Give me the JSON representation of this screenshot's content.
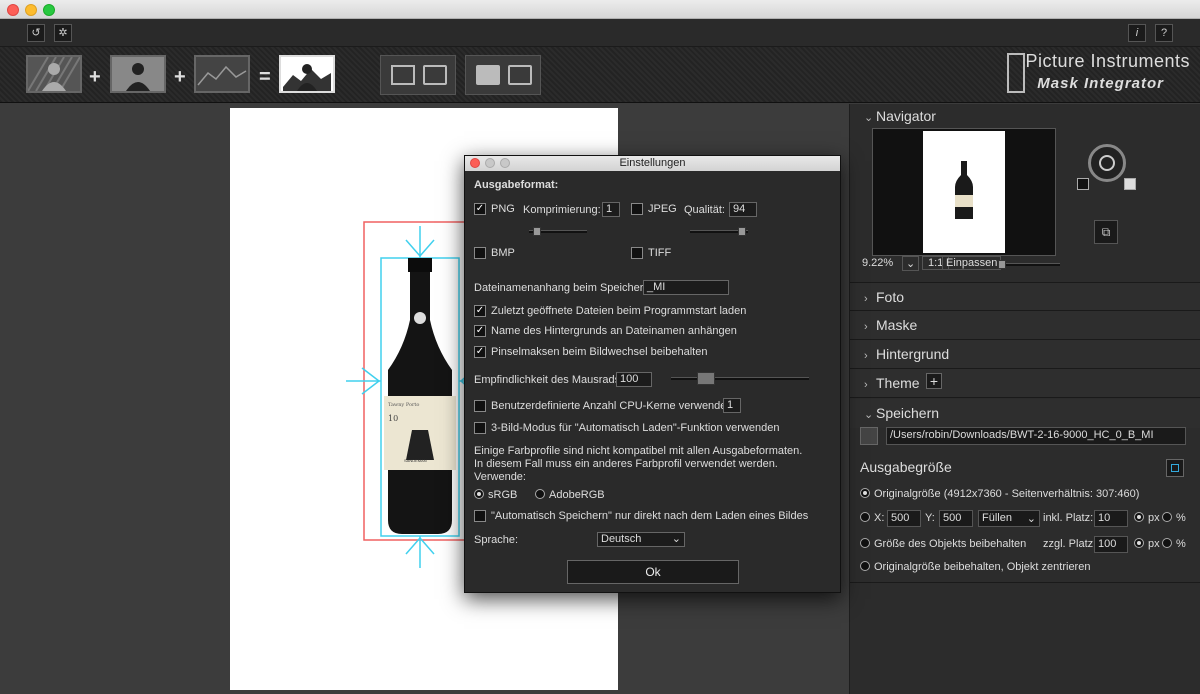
{
  "toolbar": {
    "plus1": "+",
    "plus2": "+",
    "equals": "=",
    "brand_line1": "Picture Instruments",
    "brand_line2": "Mask Integrator",
    "info_label": "i",
    "help_label": "?"
  },
  "navigator": {
    "title": "Navigator",
    "zoom": "9.22%",
    "ratio": "1:1",
    "fit_label": "Einpassen"
  },
  "sections": {
    "foto": "Foto",
    "maske": "Maske",
    "hintergrund": "Hintergrund",
    "theme": "Theme",
    "speichern": "Speichern"
  },
  "save": {
    "path": "/Users/robin/Downloads/BWT-2-16-9000_HC_0_B_MI",
    "output_size_title": "Ausgabegröße",
    "original_size": "Originalgröße (4912x7360 - Seitenverhältnis: 307:460)",
    "x_label": "X:",
    "x_value": "500",
    "y_label": "Y:",
    "y_value": "500",
    "fill_option": "Füllen",
    "inkl_label": "inkl. Platz:",
    "inkl_value": "10",
    "px_label": "px",
    "pct_label": "%",
    "keep_object_size": "Größe des Objekts beibehalten",
    "zzgl_label": "zzgl. Platz:",
    "zzgl_value": "100",
    "px_label2": "px",
    "pct_label2": "%",
    "keep_original_center": "Originalgröße beibehalten, Objekt zentrieren"
  },
  "dialog": {
    "title": "Einstellungen",
    "output_format": "Ausgabeformat:",
    "png": "PNG",
    "compression_label": "Komprimierung:",
    "compression_value": "1",
    "jpeg": "JPEG",
    "quality_label": "Qualität:",
    "quality_value": "94",
    "bmp": "BMP",
    "tiff": "TIFF",
    "suffix_label": "Dateinamenanhang beim Speichern:",
    "suffix_value": "_MI",
    "opt_recent": "Zuletzt geöffnete Dateien beim Programmstart laden",
    "opt_bgname": "Name des Hintergrunds an Dateinamen anhängen",
    "opt_brush": "Pinselmaksen beim Bildwechsel beibehalten",
    "mousewheel_label": "Empfindlichkeit des Mausrads:",
    "mousewheel_value": "100",
    "cpu_label": "Benutzerdefinierte Anzahl CPU-Kerne verwenden:",
    "cpu_value": "1",
    "threebild_label": "3-Bild-Modus für \"Automatisch Laden\"-Funktion verwenden",
    "profile_note1": "Einige Farbprofile sind nicht kompatibel mit allen Ausgabeformaten.",
    "profile_note2": "In diesem Fall muss ein anderes Farbprofil verwendet werden.",
    "use_label": "Verwende:",
    "srgb": "sRGB",
    "adobergb": "AdobeRGB",
    "autosave_label": "\"Automatisch Speichern\" nur direkt nach dem Laden eines Bildes",
    "language_label": "Sprache:",
    "language_value": "Deutsch",
    "ok_label": "Ok"
  },
  "bottle": {
    "label_top": "Tawny Porto",
    "label_year": "10",
    "label_brand": "SANDEMAN"
  }
}
